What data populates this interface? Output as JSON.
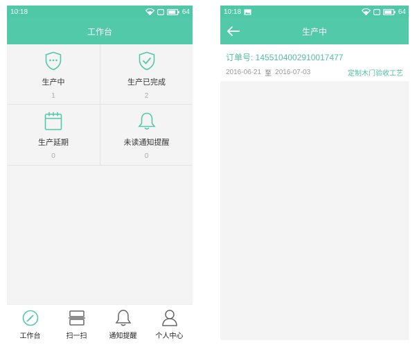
{
  "colors": {
    "accent": "#52c9a9",
    "background": "#f4f4f4",
    "text": "#333333",
    "muted": "#aaaaaa"
  },
  "status": {
    "left": {
      "time": "10:18",
      "battery": "64"
    },
    "right": {
      "time": "10:18",
      "battery": "64"
    }
  },
  "left": {
    "title": "工作台",
    "cards": [
      {
        "label": "生产中",
        "count": "1",
        "icon": "shield-dots-icon"
      },
      {
        "label": "生产已完成",
        "count": "2",
        "icon": "shield-check-icon"
      },
      {
        "label": "生产延期",
        "count": "0",
        "icon": "calendar-icon"
      },
      {
        "label": "未读通知提醒",
        "count": "0",
        "icon": "bell-icon"
      }
    ],
    "tabs": [
      {
        "label": "工作台",
        "icon": "dashboard-icon"
      },
      {
        "label": "扫一扫",
        "icon": "scan-icon"
      },
      {
        "label": "通知提醒",
        "icon": "bell-icon"
      },
      {
        "label": "个人中心",
        "icon": "user-icon"
      }
    ]
  },
  "right": {
    "title": "生产中",
    "order": {
      "number_label": "订单号: 1455104002910017477",
      "start_date": "2016-06-21",
      "separator": "至",
      "end_date": "2016-07-03",
      "process": "定制木门验收工艺"
    }
  }
}
